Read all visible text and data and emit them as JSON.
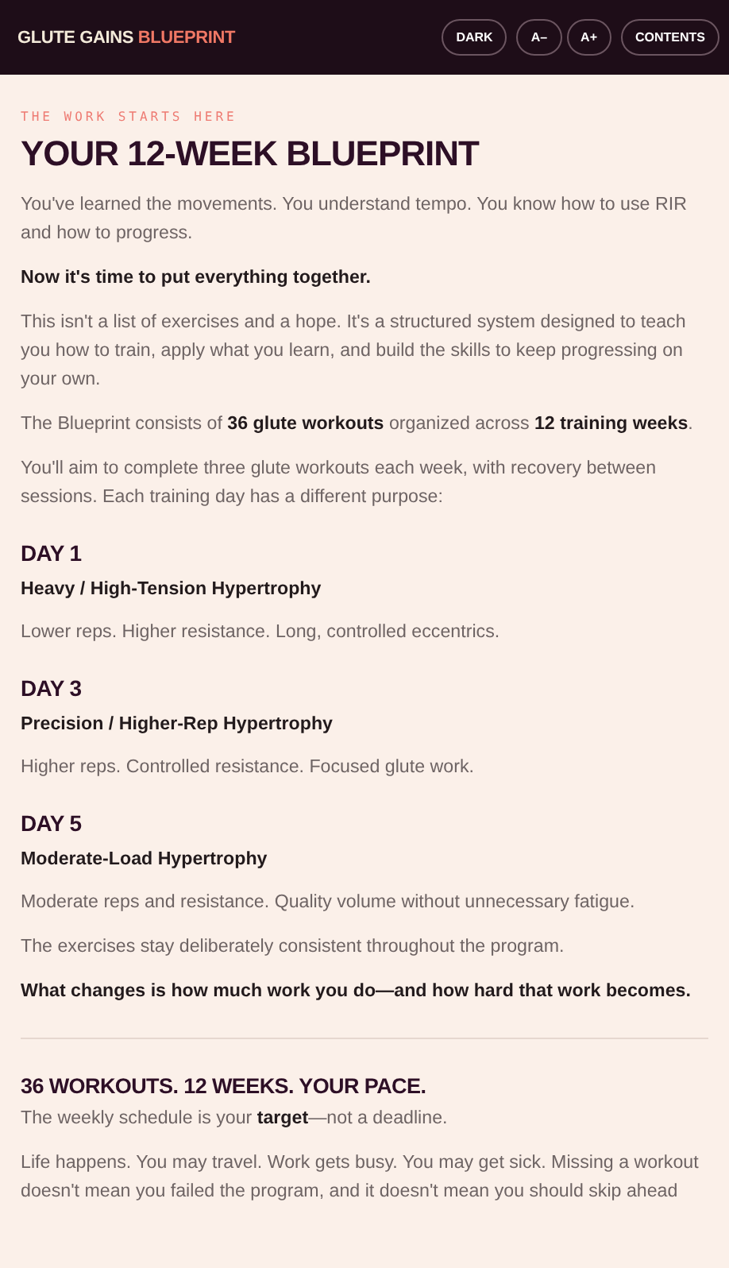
{
  "header": {
    "brand": "GLUTE GAINS",
    "brand_accent": "BLUEPRINT",
    "buttons": [
      "DARK",
      "A–",
      "A+",
      "CONTENTS"
    ]
  },
  "blocks": [
    {
      "kind": "eyebrow",
      "text": "THE WORK STARTS HERE"
    },
    {
      "kind": "title",
      "text": "YOUR 12-WEEK BLUEPRINT"
    },
    {
      "kind": "para",
      "text": "You've learned the movements. You understand tempo. You know how to use RIR and how to progress."
    },
    {
      "kind": "strong",
      "text": "Now it's time to put everything together."
    },
    {
      "kind": "para",
      "text": "This isn't a list of exercises and a hope. It's a structured system designed to teach you how to train, apply what you learn, and build the skills to keep progressing on your own."
    },
    {
      "kind": "para",
      "text": "The Blueprint consists of **36 glute workouts** organized across **12 training weeks**."
    },
    {
      "kind": "para",
      "text": "You'll aim to complete three glute workouts each week, with recovery between sessions. Each training day has a different purpose:"
    },
    {
      "kind": "day",
      "text": "DAY 1"
    },
    {
      "kind": "subhead",
      "text": "Heavy / High-Tension Hypertrophy"
    },
    {
      "kind": "para",
      "text": "Lower reps. Higher resistance. Long, controlled eccentrics."
    },
    {
      "kind": "day",
      "text": "DAY 3"
    },
    {
      "kind": "subhead",
      "text": "Precision / Higher-Rep Hypertrophy"
    },
    {
      "kind": "para",
      "text": "Higher reps. Controlled resistance. Focused glute work."
    },
    {
      "kind": "day",
      "text": "DAY 5"
    },
    {
      "kind": "subhead",
      "text": "Moderate-Load Hypertrophy"
    },
    {
      "kind": "para",
      "text": "Moderate reps and resistance. Quality volume without unnecessary fatigue."
    },
    {
      "kind": "para",
      "text": "The exercises stay deliberately consistent throughout the program."
    },
    {
      "kind": "strong",
      "text": "What changes is how much work you do—and how hard that work becomes."
    },
    {
      "kind": "rule"
    },
    {
      "kind": "section",
      "text": "36 WORKOUTS. 12 WEEKS. YOUR PACE."
    },
    {
      "kind": "para",
      "text": "The weekly schedule is your **target**—not a deadline."
    },
    {
      "kind": "para",
      "text": "Life happens. You may travel. Work gets busy. You may get sick. Missing a workout doesn't mean you failed the program, and it doesn't mean you should skip ahead"
    }
  ]
}
